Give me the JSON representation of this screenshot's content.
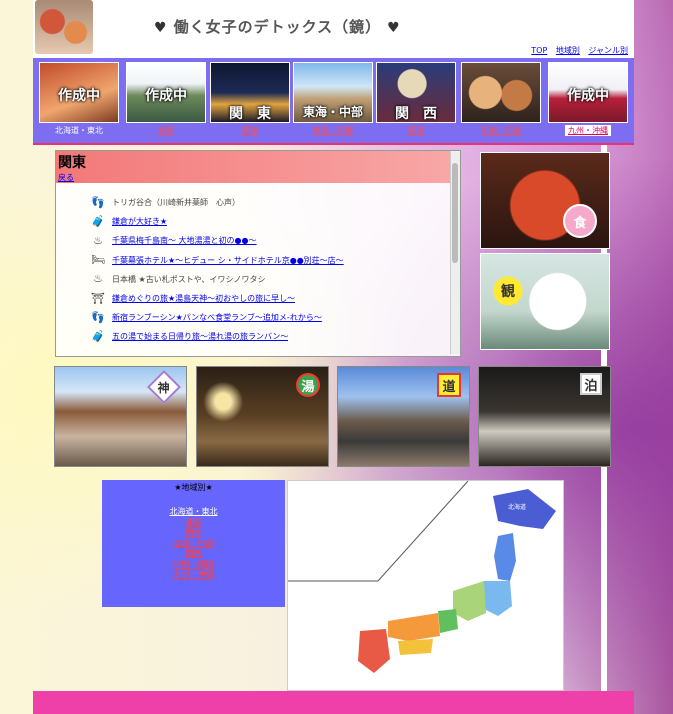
{
  "site": {
    "title": "働く女子のデトックス（鏡）",
    "heart_left": "♥",
    "heart_right": "♥"
  },
  "top_links": [
    "TOP",
    "地域別",
    "ジャンル別"
  ],
  "regions": [
    {
      "overlay": "作成中",
      "caption": "北海道・東北"
    },
    {
      "overlay": "作成中",
      "caption": "北陸"
    },
    {
      "overlay": "関　東",
      "caption": "関東"
    },
    {
      "overlay": "東海・中部",
      "caption": "東海・中部"
    },
    {
      "overlay": "関　西",
      "caption": "関西"
    },
    {
      "overlay": "",
      "caption": "中国・四国"
    },
    {
      "overlay": "作成中",
      "caption": "九州・沖縄"
    }
  ],
  "main": {
    "title": "関東",
    "back_link": "戻る",
    "articles": [
      {
        "icon": "footprints-icon",
        "glyph": "👣",
        "text": "トリガ谷合（川崎新井薬師　心声）",
        "link": false
      },
      {
        "icon": "suitcase-icon",
        "glyph": "🧳",
        "text": "鎌倉が大好き★",
        "link": true
      },
      {
        "icon": "onsen-icon",
        "glyph": "♨",
        "text": "千葉県梅千島南〜 大地湯湯と初の●●〜",
        "link": true
      },
      {
        "icon": "bed-icon",
        "glyph": "🛏",
        "text": "千葉幕張ホテル★〜ヒデュー シ・サイドホテル京●●別荘〜店〜",
        "link": true
      },
      {
        "icon": "onsen-icon",
        "glyph": "♨",
        "text": "日本橋 ★古い札ポストや、イワシノワタシ",
        "link": false
      },
      {
        "icon": "torii-icon",
        "glyph": "⛩",
        "text": "鎌倉めぐりの旅★湯島天神〜初おやしの旅に早し〜",
        "link": true
      },
      {
        "icon": "footprints-icon",
        "glyph": "👣",
        "text": "新宿ランブーシン★パンなべ食堂ランブ〜追加メ-れから〜",
        "link": true
      },
      {
        "icon": "suitcase-icon",
        "glyph": "🧳",
        "text": "五の湯で始まる日帰り旅〜湯れ湯の旅ランバン〜",
        "link": true
      }
    ]
  },
  "side_cards": [
    {
      "badge": "食",
      "label": "food"
    },
    {
      "badge": "観",
      "label": "sightseeing"
    }
  ],
  "photos": [
    {
      "badge": "神"
    },
    {
      "badge": "湯"
    },
    {
      "badge": "道"
    },
    {
      "badge": "泊"
    }
  ],
  "areas": {
    "heading": "★地域別★",
    "items": [
      "北海道・東北",
      "北陸",
      "関東",
      "東海・中部",
      "関西",
      "中国・四国",
      "九州・沖縄"
    ]
  },
  "map": {
    "label_hokkaido": "北海道"
  },
  "colors": {
    "region_bg": "#7d6df0",
    "accent_pink": "#ef3fa9",
    "main_head": "#f37878"
  }
}
